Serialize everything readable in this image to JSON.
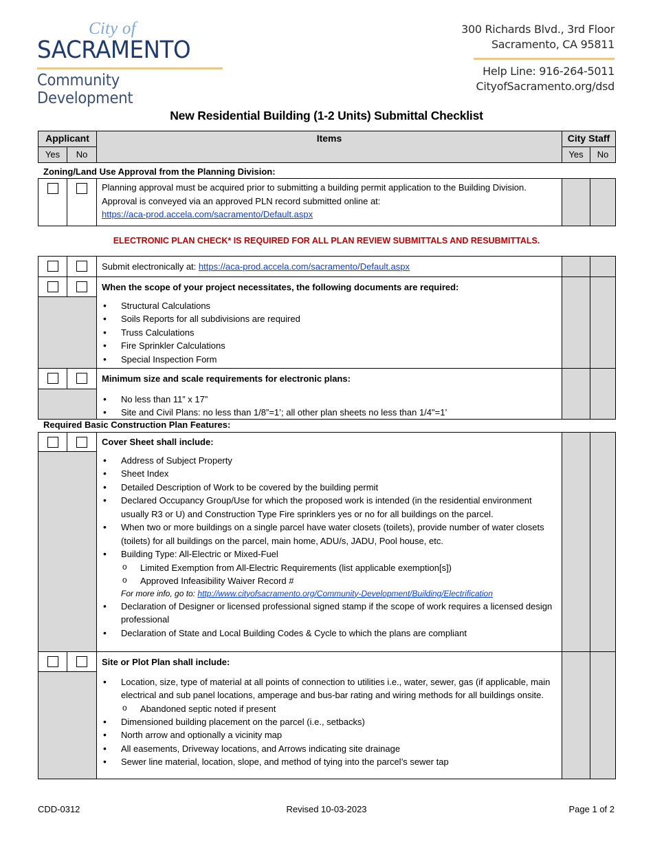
{
  "header": {
    "logo": {
      "city_of": "City of",
      "name": "SACRAMENTO",
      "department": "Community Development"
    },
    "address_line1": "300 Richards Blvd., 3rd Floor",
    "address_line2": "Sacramento, CA 95811",
    "help_line": "Help Line: 916-264-5011",
    "website": "CityofSacramento.org/dsd"
  },
  "title": "New Residential Building (1-2 Units) Submittal Checklist",
  "table_header": {
    "applicant": "Applicant",
    "items": "Items",
    "city_staff": "City Staff",
    "yes": "Yes",
    "no": "No"
  },
  "sections": {
    "zoning": {
      "label": "Zoning/Land Use Approval from the Planning Division:",
      "text": "Planning approval must be acquired prior to submitting a building permit application to the Building Division. Approval is conveyed via an approved PLN record submitted online at:",
      "link": "https://aca-prod.accela.com/sacramento/Default.aspx"
    },
    "notice": "ELECTRONIC PLAN CHECK* IS REQUIRED FOR ALL PLAN REVIEW SUBMITTALS AND RESUBMITTALS.",
    "submit": {
      "text": "Submit electronically at: ",
      "link": "https://aca-prod.accela.com/sacramento/Default.aspx"
    },
    "documents": {
      "heading": "When the scope of your project necessitates, the following documents are required:",
      "items": [
        "Structural Calculations",
        "Soils Reports for all subdivisions are required",
        "Truss Calculations",
        "Fire Sprinkler Calculations",
        "Special Inspection Form"
      ]
    },
    "min_size": {
      "heading": "Minimum size and scale requirements for electronic plans:",
      "items": [
        "No less than 11” x 17”",
        "Site and Civil Plans: no less than 1/8”=1’; all other plan sheets no less than 1/4\"=1’"
      ]
    },
    "basic_features": {
      "label": "Required Basic Construction Plan Features:"
    },
    "cover_sheet": {
      "heading": "Cover Sheet shall include:",
      "items": [
        "Address of Subject Property",
        "Sheet Index",
        "Detailed Description of Work to be covered by the building permit",
        "Declared Occupancy Group/Use for which the proposed work is intended (in the residential environment usually R3 or U) and Construction Type Fire sprinklers yes or no for all buildings on the parcel.",
        "When two or more buildings on a single parcel have water closets (toilets), provide number of water closets (toilets) for all buildings on the parcel, main home, ADU/s, JADU, Pool house, etc.",
        "Building Type: All-Electric or Mixed-Fuel"
      ],
      "building_type_sub": [
        "Limited Exemption from All-Electric Requirements (list applicable exemption[s])",
        "Approved Infeasibility Waiver Record #"
      ],
      "more_info_label": "For more info, go to: ",
      "more_info_link": "http://www.cityofsacramento.org/Community-Development/Building/Electrification",
      "items_after": [
        "Declaration of Designer or licensed professional signed stamp if the scope of work requires a licensed design professional",
        "Declaration of State and Local Building Codes & Cycle to which the plans are compliant"
      ]
    },
    "site_plan": {
      "heading": "Site or Plot Plan shall include:",
      "first_item": "Location, size, type of material at all points of connection to utilities i.e., water, sewer, gas (if applicable, main electrical and sub panel locations, amperage and bus-bar rating and wiring methods for all buildings onsite.",
      "first_sub": [
        "Abandoned septic noted if present"
      ],
      "items": [
        "Dimensioned building placement on the parcel (i.e., setbacks)",
        "North arrow and optionally a vicinity map",
        "All easements, Driveway locations, and Arrows indicating site drainage",
        "Sewer line material, location, slope, and method of tying into the parcel’s sewer tap"
      ]
    }
  },
  "footer": {
    "form_number": "CDD-0312",
    "revised": "Revised 10-03-2023",
    "page": "Page 1 of 2"
  },
  "colors": {
    "header_shade": "#d9d9d9",
    "notice_red": "#c00000",
    "link_blue": "#0b3fd6",
    "logo_navy": "#1f3a6b",
    "logo_light_blue": "#7fa9d4",
    "accent_gold": "#e9c98a"
  }
}
